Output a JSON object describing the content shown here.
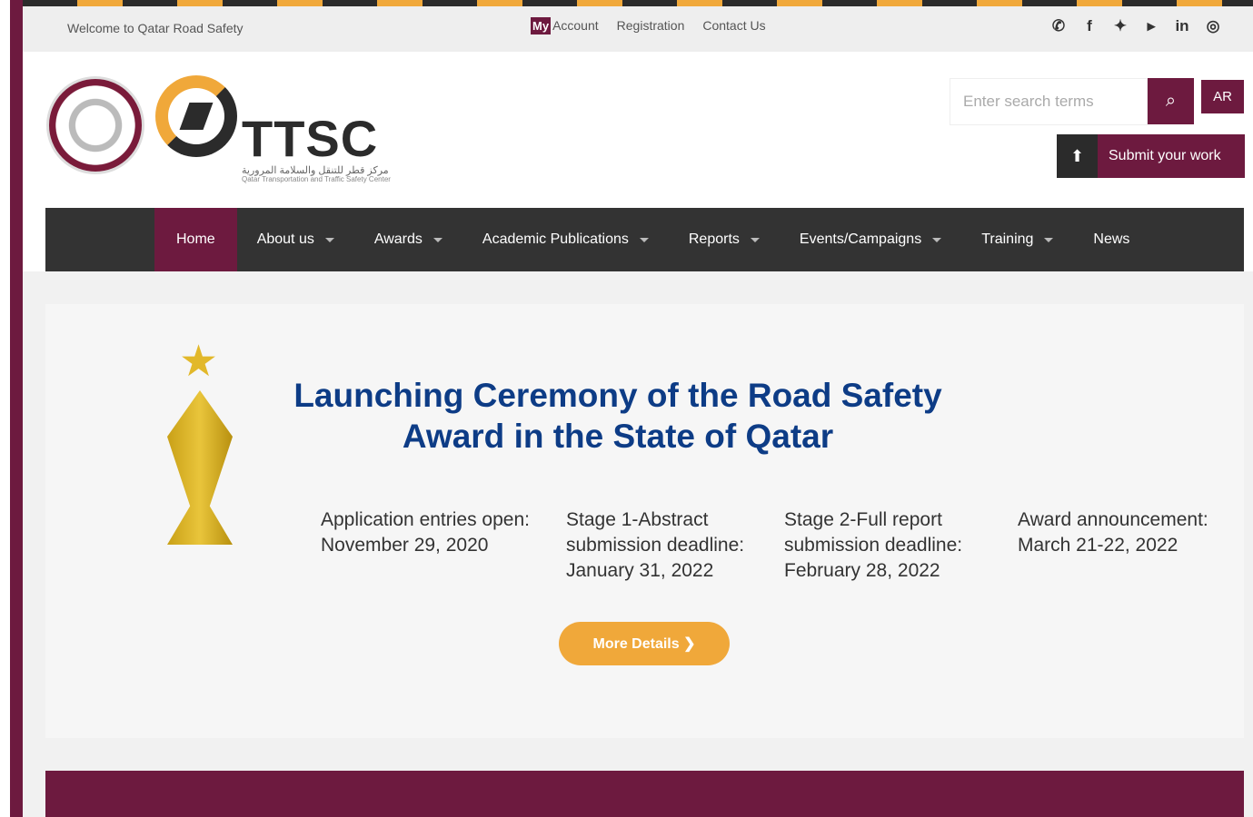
{
  "topbar": {
    "welcome": "Welcome to Qatar Road Safety",
    "my_badge": "My",
    "account": "Account",
    "registration": "Registration",
    "contact": "Contact Us",
    "socials": [
      "whatsapp-icon",
      "facebook-icon",
      "twitter-icon",
      "youtube-icon",
      "linkedin-icon",
      "instagram-icon"
    ]
  },
  "header": {
    "logo_text": "TTSC",
    "logo_sub_ar": "مركز قطر للتنقل والسلامة المرورية",
    "logo_sub_en": "Qatar Transportation and Traffic Safety Center",
    "search_placeholder": "Enter search terms",
    "ar_label": "AR",
    "submit_label": "Submit your work"
  },
  "nav": {
    "items": [
      {
        "label": "Home",
        "active": true
      },
      {
        "label": "About us",
        "dropdown": true
      },
      {
        "label": "Awards",
        "dropdown": true
      },
      {
        "label": "Academic Publications",
        "dropdown": true
      },
      {
        "label": "Reports",
        "dropdown": true
      },
      {
        "label": "Events/Campaigns",
        "dropdown": true
      },
      {
        "label": "Training",
        "dropdown": true
      },
      {
        "label": "News"
      }
    ]
  },
  "banner": {
    "title_line1": "Launching Ceremony of the Road Safety",
    "title_line2": "Award in the State of Qatar",
    "col1": [
      "Application entries open:",
      "November 29, 2020"
    ],
    "col2": [
      "Stage 1-Abstract",
      "submission deadline:",
      "January 31, 2022"
    ],
    "col3": [
      "Stage 2-Full report",
      "submission deadline:",
      "February 28, 2022"
    ],
    "col4": [
      "Award announcement:",
      "March 21-22, 2022"
    ],
    "more_label": "More Details ❯"
  },
  "colors": {
    "brand": "#6d1a3f",
    "accent": "#f0a83a",
    "title": "#0d3c86",
    "nav": "#333333"
  }
}
